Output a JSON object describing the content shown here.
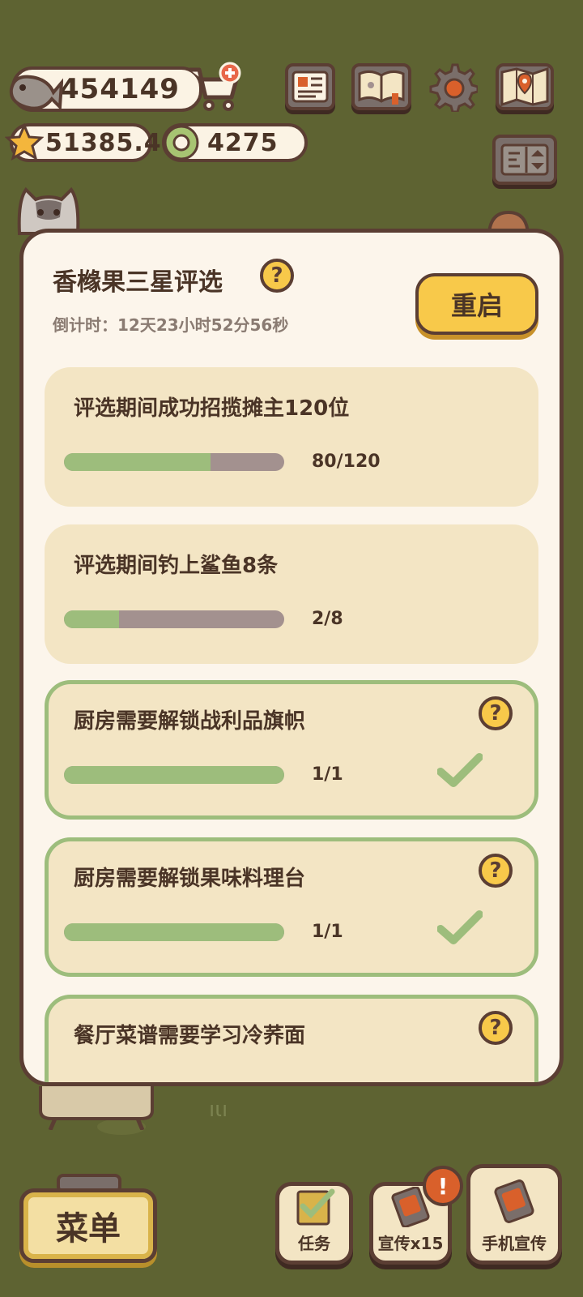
{
  "currencies": {
    "fish": "454149",
    "stars": "51385.4",
    "rings": "4275"
  },
  "event": {
    "title": "香橼果三星评选",
    "countdown": "倒计时：12天23小时52分56秒",
    "restart_label": "重启"
  },
  "tasks": [
    {
      "title": "评选期间成功招揽摊主120位",
      "progress": "80/120",
      "fraction": 0.667,
      "done": false,
      "help": false
    },
    {
      "title": "评选期间钓上鲨鱼8条",
      "progress": "2/8",
      "fraction": 0.25,
      "done": false,
      "help": false
    },
    {
      "title": "厨房需要解锁战利品旗帜",
      "progress": "1/1",
      "fraction": 1.0,
      "done": true,
      "help": true
    },
    {
      "title": "厨房需要解锁果味料理台",
      "progress": "1/1",
      "fraction": 1.0,
      "done": true,
      "help": true
    },
    {
      "title": "餐厅菜谱需要学习冷荞面",
      "progress": "",
      "fraction": 0,
      "done": true,
      "help": true
    }
  ],
  "bottom": {
    "menu_label": "菜单",
    "tasks_label": "任务",
    "promo_label": "宣传x15",
    "phone_promo_label": "手机宣传",
    "badge": "!"
  },
  "icons": {
    "help": "?",
    "check": "check-icon"
  },
  "colors": {
    "accent_yellow": "#f8c94a",
    "progress_green": "#9dbd7c",
    "progress_track": "#a3918f",
    "panel": "#fcf5eb",
    "card": "#f3e5c4",
    "outline": "#5b3e33"
  }
}
